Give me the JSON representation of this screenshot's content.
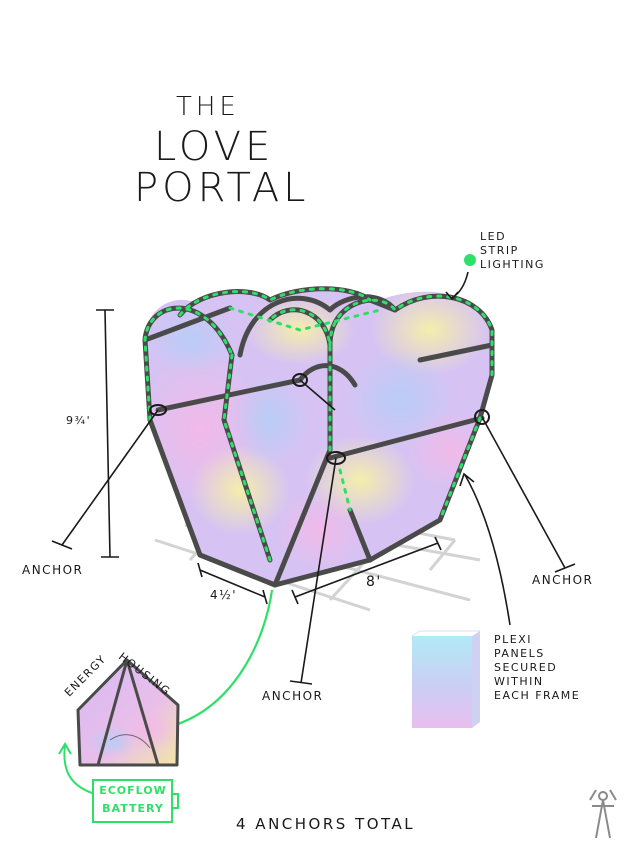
{
  "title": {
    "line1": "THE",
    "line2": "LOVE",
    "line3": "PORTAL"
  },
  "labels": {
    "led": [
      "LED",
      "STRIP",
      "LIGHTING"
    ],
    "anchor_left": "ANCHOR",
    "anchor_center": "ANCHOR",
    "anchor_right": "ANCHOR",
    "height_dim": "9¾'",
    "width_dim": "4½'",
    "depth_dim": "8'",
    "plexi": [
      "PLEXI",
      "PANELS",
      "SECURED",
      "WITHIN",
      "EACH FRAME"
    ],
    "energy": "ENERGY",
    "housing": "HOUSING",
    "battery": [
      "ECOFLOW",
      "BATTERY"
    ],
    "footer": "4 ANCHORS TOTAL"
  },
  "colors": {
    "frame": "#4a4a4a",
    "led": "#2ee06a",
    "ink": "#1a1a1a",
    "panel_pink": "#f3b9e8",
    "panel_lilac": "#c9b8f2",
    "panel_blue": "#b7cdf6",
    "panel_yellow": "#f6f0a8"
  },
  "icons": {
    "led_dot": "green-dot-icon",
    "artist_mark": "figure-logo-icon"
  }
}
